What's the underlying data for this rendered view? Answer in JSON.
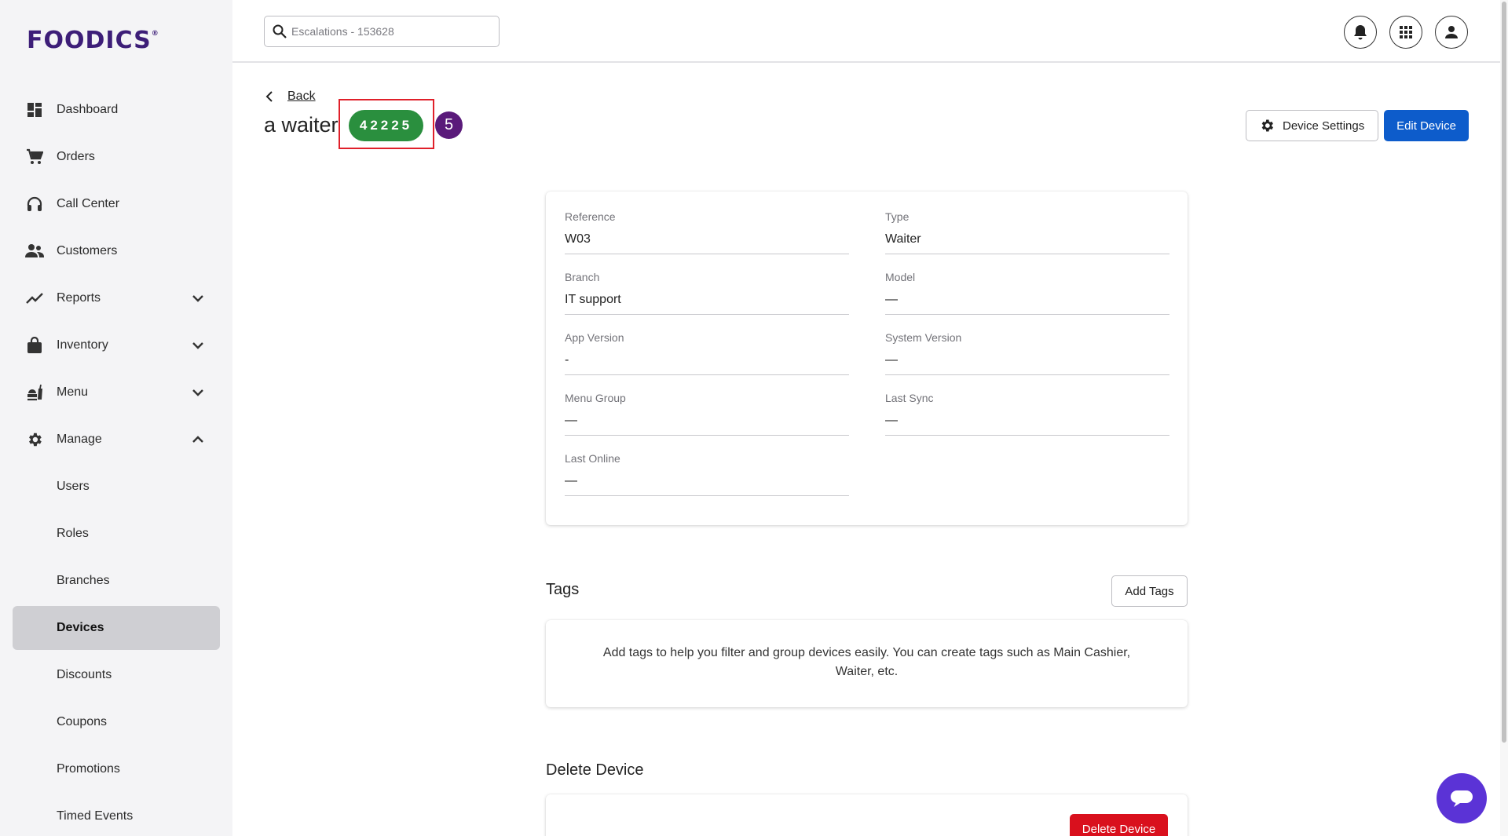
{
  "brand": {
    "logo_text": "FOODICS",
    "logo_mark": "®",
    "color": "#3d1e78"
  },
  "header": {
    "search_placeholder": "Escalations - 153628",
    "icons": [
      "bell-icon",
      "apps-grid-icon",
      "user-account-icon"
    ]
  },
  "sidebar": {
    "items": [
      {
        "label": "Dashboard",
        "icon": "dashboard-icon"
      },
      {
        "label": "Orders",
        "icon": "cart-icon"
      },
      {
        "label": "Call Center",
        "icon": "headset-icon"
      },
      {
        "label": "Customers",
        "icon": "people-icon"
      },
      {
        "label": "Reports",
        "icon": "trend-icon",
        "expanded": false
      },
      {
        "label": "Inventory",
        "icon": "bag-icon",
        "expanded": false
      },
      {
        "label": "Menu",
        "icon": "food-icon",
        "expanded": false
      },
      {
        "label": "Manage",
        "icon": "gear-icon",
        "expanded": true
      }
    ],
    "manage_subitems": [
      {
        "label": "Users"
      },
      {
        "label": "Roles"
      },
      {
        "label": "Branches"
      },
      {
        "label": "Devices",
        "active": true
      },
      {
        "label": "Discounts"
      },
      {
        "label": "Coupons"
      },
      {
        "label": "Promotions"
      },
      {
        "label": "Timed Events"
      }
    ]
  },
  "page": {
    "back_label": "Back",
    "title": "a waiter",
    "badge": "42225",
    "step_marker": "5",
    "device_settings_label": "Device Settings",
    "edit_device_label": "Edit Device"
  },
  "details": {
    "reference": {
      "label": "Reference",
      "value": "W03"
    },
    "type": {
      "label": "Type",
      "value": "Waiter"
    },
    "branch": {
      "label": "Branch",
      "value": "IT support"
    },
    "model": {
      "label": "Model",
      "value": "—"
    },
    "app_version": {
      "label": "App Version",
      "value": "-"
    },
    "system_version": {
      "label": "System Version",
      "value": "—"
    },
    "menu_group": {
      "label": "Menu Group",
      "value": "—"
    },
    "last_sync": {
      "label": "Last Sync",
      "value": "—"
    },
    "last_online": {
      "label": "Last Online",
      "value": "—"
    }
  },
  "tags": {
    "title": "Tags",
    "add_label": "Add Tags",
    "empty_text": "Add tags to help you filter and group devices easily. You can create tags such as Main Cashier, Waiter, etc."
  },
  "delete": {
    "title": "Delete Device",
    "button_label": "Delete Device"
  },
  "colors": {
    "primary": "#0d5ccb",
    "success": "#2a8f3e",
    "danger": "#d9101d",
    "highlight": "#e0202a",
    "marker": "#5a1a7a",
    "chat": "#5b33d6"
  }
}
